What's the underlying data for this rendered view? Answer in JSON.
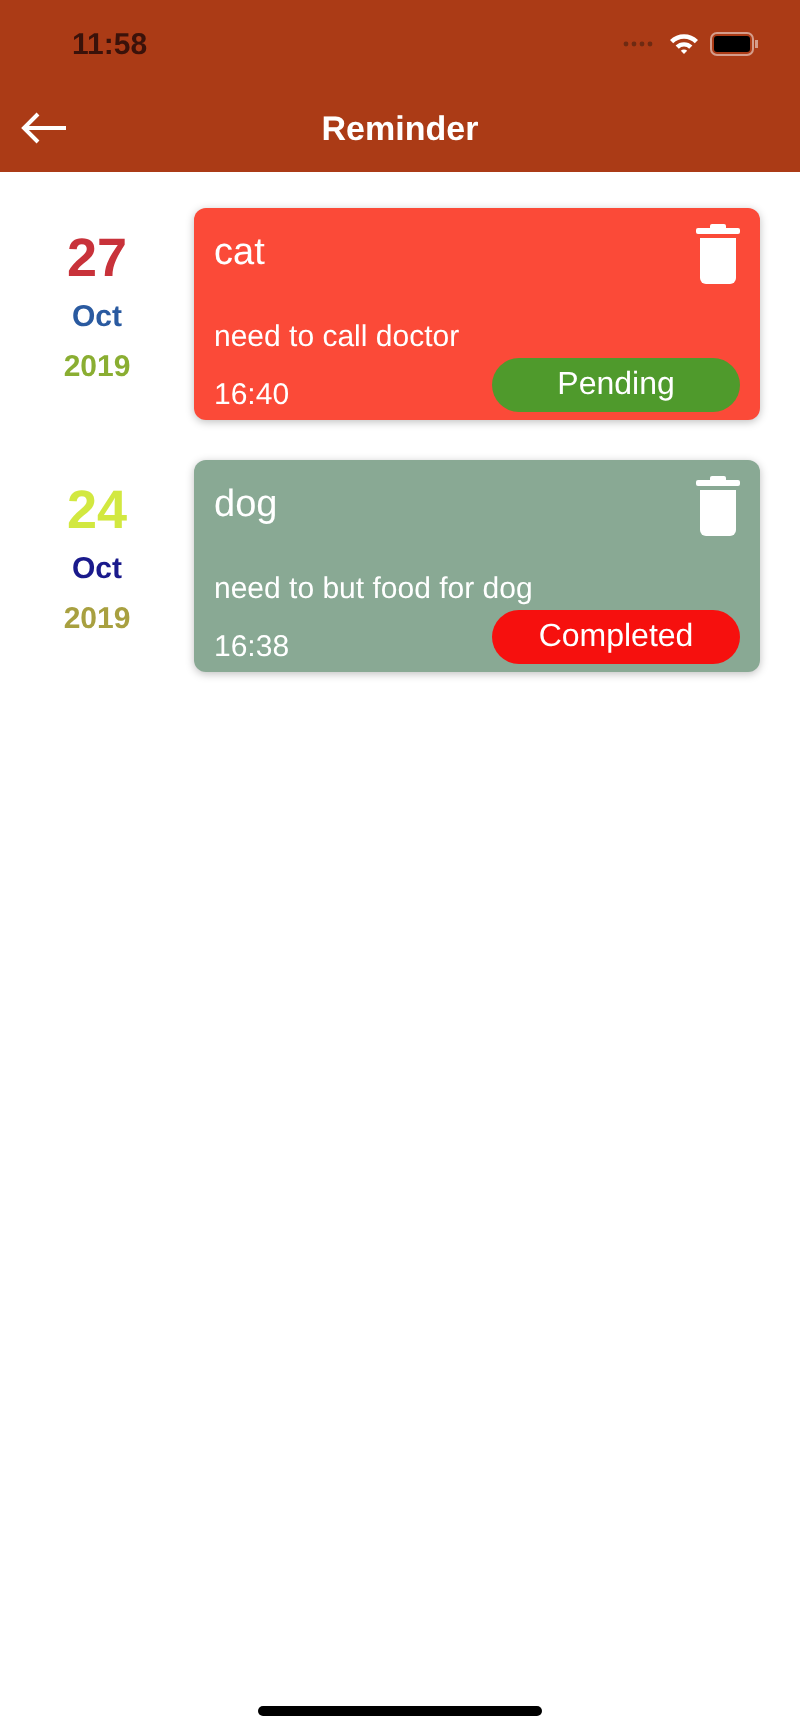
{
  "status_bar": {
    "time": "11:58"
  },
  "nav": {
    "title": "Reminder"
  },
  "reminders": [
    {
      "day": {
        "text": "27",
        "color": "#c8323a"
      },
      "month": {
        "text": "Oct",
        "color": "#2a5aa0"
      },
      "year": {
        "text": "2019",
        "color": "#8aae32"
      },
      "color": "#fb4a38",
      "title": "cat",
      "note": "need to call doctor",
      "time": "16:40",
      "status": "Pending",
      "kind": "pending"
    },
    {
      "day": {
        "text": "24",
        "color": "#d2e840"
      },
      "month": {
        "text": "Oct",
        "color": "#1a1a8c"
      },
      "year": {
        "text": "2019",
        "color": "#a8a040"
      },
      "color": "#89a994",
      "title": "dog",
      "note": "need to but food for dog",
      "time": "16:38",
      "status": "Completed",
      "kind": "completed"
    }
  ]
}
